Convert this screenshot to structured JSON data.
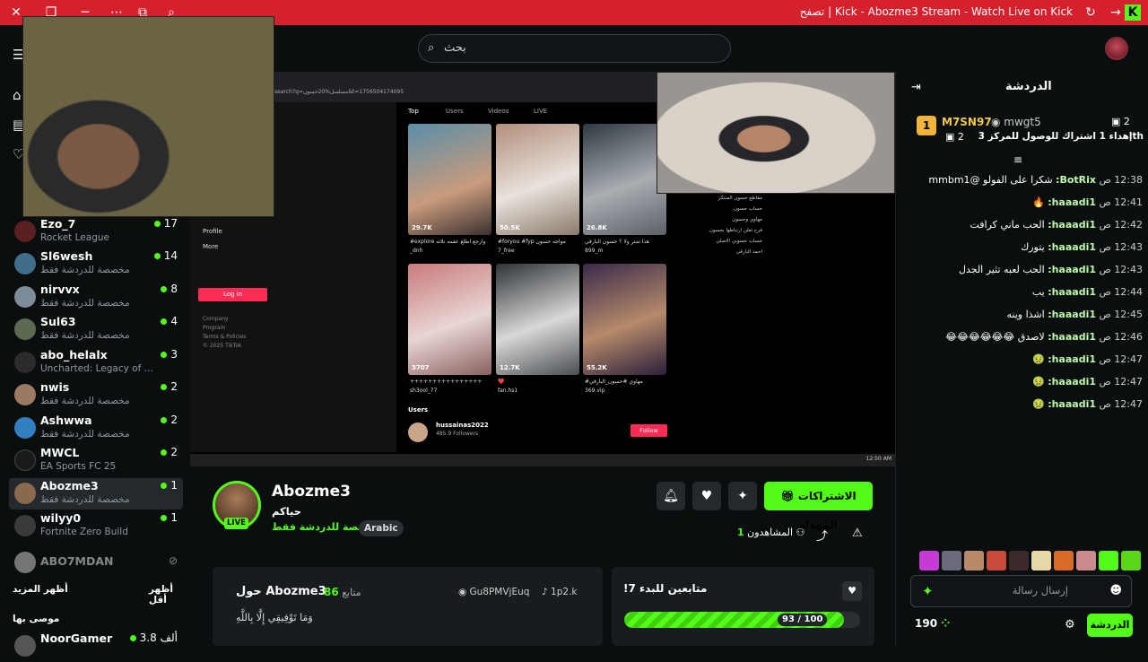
{
  "browser": {
    "window_title": "Kick - Abozme3 Stream - Watch Live on Kick | تصفح",
    "icons": [
      "close-icon",
      "tabs-icon",
      "minimize-icon",
      "more-icon",
      "favorites-icon",
      "find-icon",
      "refresh-icon",
      "forward-icon",
      "kick-logo"
    ]
  },
  "topnav": {
    "search_placeholder": "بحث"
  },
  "sidebar": {
    "channels": [
      {
        "name": "Ezo_7",
        "category": "Rocket League",
        "viewers": "17"
      },
      {
        "name": "Sl6wesh",
        "category": "مخصصة للدردشة فقط",
        "viewers": "14"
      },
      {
        "name": "nirvvx",
        "category": "مخصصة للدردشة فقط",
        "viewers": "8"
      },
      {
        "name": "Sul63",
        "category": "مخصصة للدردشة فقط",
        "viewers": "4"
      },
      {
        "name": "abo_helalx",
        "category": "Uncharted: Legacy of Th...",
        "viewers": "3"
      },
      {
        "name": "nwis",
        "category": "مخصصة للدردشة فقط",
        "viewers": "2"
      },
      {
        "name": "Ashwwa",
        "category": "مخصصة للدردشة فقط",
        "viewers": "2"
      },
      {
        "name": "MWCL",
        "category": "EA Sports FC 25",
        "viewers": "2"
      },
      {
        "name": "Abozme3",
        "category": "مخصصة للدردشة فقط",
        "viewers": "1"
      },
      {
        "name": "wilyy0",
        "category": "Fortnite Zero Build",
        "viewers": "1"
      }
    ],
    "offline_channel": "ABO7MDAN",
    "show_more": "أظهر المزيد",
    "show_less": "أظهر أقل",
    "recommended_title": "موصى بها",
    "recommended": [
      {
        "name": "NoorGamer",
        "viewers": "3.8 ألف"
      }
    ]
  },
  "player": {
    "tiktok": {
      "url": "/search?q=مسلسل%20حسون&t=1756504174095",
      "tabs": [
        "Top",
        "Users",
        "Videos",
        "LIVE"
      ],
      "left_menu": [
        "Profile",
        "More"
      ],
      "login_label": "Log in",
      "footer_links": [
        "Company",
        "Program",
        "Terms & Policies",
        "© 2025 TikTok"
      ],
      "thumbnails": [
        {
          "likes": "29.7K",
          "author": "_dnh",
          "date": "6-29",
          "caption": "#explore وارجع اطلع عقمه تلاته"
        },
        {
          "likes": "50.5K",
          "author": "7_free",
          "date": "2024-10-1",
          "caption": "#foryou #fyp مواجه حسون"
        },
        {
          "likes": "26.8K",
          "author": "899_m",
          "date": "7-4",
          "caption": "هذا تمتر ولا ؟ حسون البارقي"
        },
        {
          "likes": "3707",
          "author": "sh3ool_77",
          "date": "8-4",
          "caption": "++++++++++++++++"
        },
        {
          "likes": "12.7K",
          "author": "fan.hs1",
          "date": "4-24",
          "caption": "❤️"
        },
        {
          "likes": "55.2K",
          "author": "369.vip",
          "date": "2-21",
          "caption": "#مهاوي #حسون_البارقي"
        }
      ],
      "suggestions": [
        "مقاطع حسون المتنكر",
        "حساب حسون",
        "مهاوي وحسون",
        "فرح تعلن ارتباطها بحسون",
        "حساب حسوني الاصلي",
        "احمد البارقي"
      ],
      "users_label": "Users",
      "user_result": {
        "handle": "hussainas2022",
        "followers": "485.9 Followers",
        "follow_label": "Follow"
      },
      "taskbar_time": "12:50 AM"
    }
  },
  "stream_info": {
    "streamer": "Abozme3",
    "live_label": "LIVE",
    "title": "حياكم",
    "category": "مخصصة للدردشة فقط",
    "language": "Arabic",
    "subscribe_label": "الاشتراكات المُهداة",
    "viewers_label": "المشاهدون",
    "viewers_count": "1",
    "about": {
      "title": "حول Abozme3",
      "followers_count": "86",
      "followers_label": "متابع",
      "discord": "Gu8PMVjEuq",
      "tiktok": "1p2.k",
      "bio": "وَمَا تَوْفِيقِي إِلَّا بِاللَّهِ"
    },
    "goal": {
      "title": "!متابعين للبدء 7",
      "current": 93,
      "target": 100,
      "label": "93 / 100"
    }
  },
  "chat": {
    "title": "الدردشة",
    "gift_leaders": [
      {
        "name": "M7SN97",
        "rank": "1",
        "count": "2"
      },
      {
        "name": "mwgt5",
        "rank": "2",
        "count": "1"
      }
    ],
    "gift_progress_text": "إهداء 1 اشتراك للوصول للمركز 3",
    "rank_suffix": "th",
    "messages": [
      {
        "time": "12:38 ص",
        "user": "BotRix:",
        "text": "شكرا على الفولو @mmbm1"
      },
      {
        "time": "12:41 ص",
        "user": "haaadi1:",
        "text": "🔥"
      },
      {
        "time": "12:42 ص",
        "user": "haaadi1:",
        "text": "الحب ماني كرافت"
      },
      {
        "time": "12:43 ص",
        "user": "haaadi1:",
        "text": "يتورك"
      },
      {
        "time": "12:43 ص",
        "user": "haaadi1:",
        "text": "الحب لعبه تثير الجدل"
      },
      {
        "time": "12:44 ص",
        "user": "haaadi1:",
        "text": "يب"
      },
      {
        "time": "12:45 ص",
        "user": "haaadi1:",
        "text": "اشذا وينه"
      },
      {
        "time": "12:46 ص",
        "user": "haaadi1:",
        "text": "لاصدق 😂😂😂😂😂😂"
      },
      {
        "time": "12:47 ص",
        "user": "haaadi1:",
        "text": "🤢"
      },
      {
        "time": "12:47 ص",
        "user": "haaadi1:",
        "text": "🤢"
      },
      {
        "time": "12:47 ص",
        "user": "haaadi1:",
        "text": "🤢"
      }
    ],
    "input_placeholder": "إرسال رسالة",
    "send_label": "الدردشة",
    "points": "190"
  },
  "colors": {
    "accent": "#53fc18",
    "titlebar": "#d5212e",
    "background": "#0b0e0f"
  }
}
